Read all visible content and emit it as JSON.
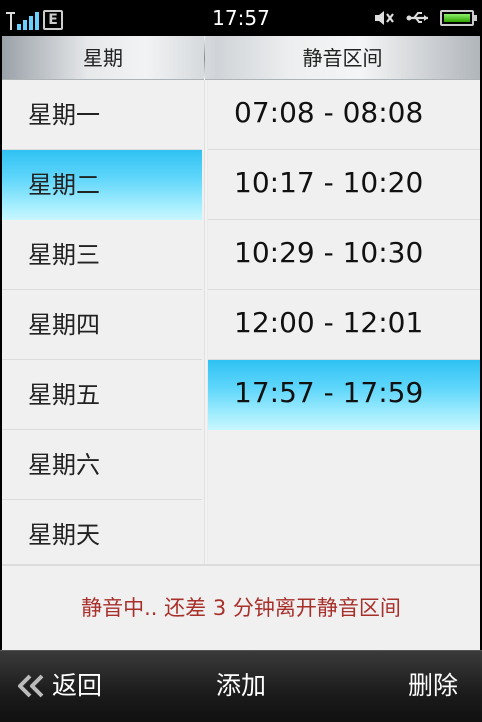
{
  "status_bar": {
    "time": "17:57",
    "network_badge": "E"
  },
  "header": {
    "day_column": "星期",
    "range_column": "静音区间"
  },
  "days": [
    "星期一",
    "星期二",
    "星期三",
    "星期四",
    "星期五",
    "星期六",
    "星期天"
  ],
  "selected_day_index": 1,
  "ranges": [
    "07:08 - 08:08",
    "10:17 - 10:20",
    "10:29 - 10:30",
    "12:00 - 12:01",
    "17:57 - 17:59"
  ],
  "selected_range_index": 4,
  "status_message": "静音中.. 还差 3 分钟离开静音区间",
  "toolbar": {
    "back_label": "返回",
    "add_label": "添加",
    "delete_label": "删除"
  },
  "colors": {
    "selection": "#5fd6fb",
    "status_text": "#a8302b"
  }
}
